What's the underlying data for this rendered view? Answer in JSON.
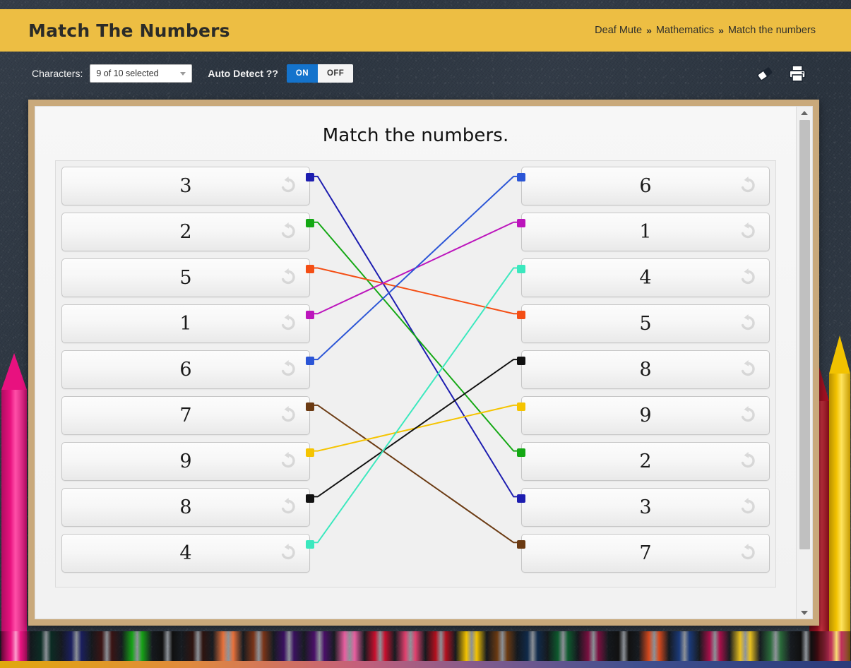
{
  "header": {
    "title": "Match The Numbers",
    "breadcrumb": [
      {
        "label": "Deaf Mute"
      },
      {
        "label": "Mathematics"
      },
      {
        "label": "Match the numbers"
      }
    ],
    "separator": "»",
    "bg_color": "#EDBE43"
  },
  "toolbar": {
    "characters_label": "Characters:",
    "characters_value": "9 of 10 selected",
    "auto_detect_label": "Auto Detect ??",
    "toggle_on": "ON",
    "toggle_off": "OFF",
    "toggle_state": "ON",
    "on_color": "#1473CC",
    "eraser_icon": "eraser-icon",
    "print_icon": "printer-icon"
  },
  "worksheet": {
    "title": "Match the numbers.",
    "frame_color": "#C9A97B"
  },
  "chart_data": {
    "type": "diagram",
    "title": "Match the numbers.",
    "left_column": [
      {
        "index": 1,
        "value": "3",
        "color": "#1D1DB0"
      },
      {
        "index": 2,
        "value": "2",
        "color": "#14A814"
      },
      {
        "index": 3,
        "value": "5",
        "color": "#F44E14"
      },
      {
        "index": 4,
        "value": "1",
        "color": "#BC15BC"
      },
      {
        "index": 5,
        "value": "6",
        "color": "#2B55D6"
      },
      {
        "index": 6,
        "value": "7",
        "color": "#6B3A12"
      },
      {
        "index": 7,
        "value": "9",
        "color": "#F5C400"
      },
      {
        "index": 8,
        "value": "8",
        "color": "#111111"
      },
      {
        "index": 9,
        "value": "4",
        "color": "#3BE8BE"
      }
    ],
    "right_column": [
      {
        "index": 1,
        "value": "6",
        "color": "#2B55D6"
      },
      {
        "index": 2,
        "value": "1",
        "color": "#BC15BC"
      },
      {
        "index": 3,
        "value": "4",
        "color": "#3BE8BE"
      },
      {
        "index": 4,
        "value": "5",
        "color": "#F44E14"
      },
      {
        "index": 5,
        "value": "8",
        "color": "#111111"
      },
      {
        "index": 6,
        "value": "9",
        "color": "#F5C400"
      },
      {
        "index": 7,
        "value": "2",
        "color": "#14A814"
      },
      {
        "index": 8,
        "value": "3",
        "color": "#1D1DB0"
      },
      {
        "index": 9,
        "value": "7",
        "color": "#6B3A12"
      }
    ],
    "connections": [
      {
        "from_index": 1,
        "to_index": 8,
        "from_value": "3",
        "to_value": "3",
        "color": "#1D1DB0"
      },
      {
        "from_index": 2,
        "to_index": 7,
        "from_value": "2",
        "to_value": "2",
        "color": "#14A814"
      },
      {
        "from_index": 3,
        "to_index": 4,
        "from_value": "5",
        "to_value": "5",
        "color": "#F44E14"
      },
      {
        "from_index": 4,
        "to_index": 2,
        "from_value": "1",
        "to_value": "1",
        "color": "#BC15BC"
      },
      {
        "from_index": 5,
        "to_index": 1,
        "from_value": "6",
        "to_value": "6",
        "color": "#2B55D6"
      },
      {
        "from_index": 6,
        "to_index": 9,
        "from_value": "7",
        "to_value": "7",
        "color": "#6B3A12"
      },
      {
        "from_index": 7,
        "to_index": 6,
        "from_value": "9",
        "to_value": "9",
        "color": "#F5C400"
      },
      {
        "from_index": 8,
        "to_index": 5,
        "from_value": "8",
        "to_value": "8",
        "color": "#111111"
      },
      {
        "from_index": 9,
        "to_index": 3,
        "from_value": "4",
        "to_value": "4",
        "color": "#3BE8BE"
      }
    ],
    "undo_icon": "undo-icon",
    "legend": "Each coloured square on the left is joined by a coloured line to the matching number on the right."
  },
  "scrollbar": {
    "up_icon": "scroll-up-arrow-icon",
    "down_icon": "scroll-down-arrow-icon"
  },
  "decor": {
    "pencil_left_color": "#E8117F",
    "pencil_right_color_a": "#9E1022",
    "pencil_right_color_b": "#F2C200",
    "bottom_pencil_colors": [
      "#E8117F",
      "#0C2C24",
      "#1B1F5E",
      "#3A1414",
      "#17A317",
      "#101010",
      "#2E1410",
      "#E8723C",
      "#7A3418",
      "#3B1160",
      "#4A1068",
      "#E85FA0",
      "#C8102E",
      "#E0406E",
      "#B4101E",
      "#F2C200",
      "#6B3A12",
      "#102A4A",
      "#0E5A2E",
      "#7A1040",
      "#111111",
      "#D64A1E",
      "#1B3A7A",
      "#A8104A",
      "#E8C020",
      "#2A6A3A",
      "#101010",
      "#C0305A"
    ]
  }
}
